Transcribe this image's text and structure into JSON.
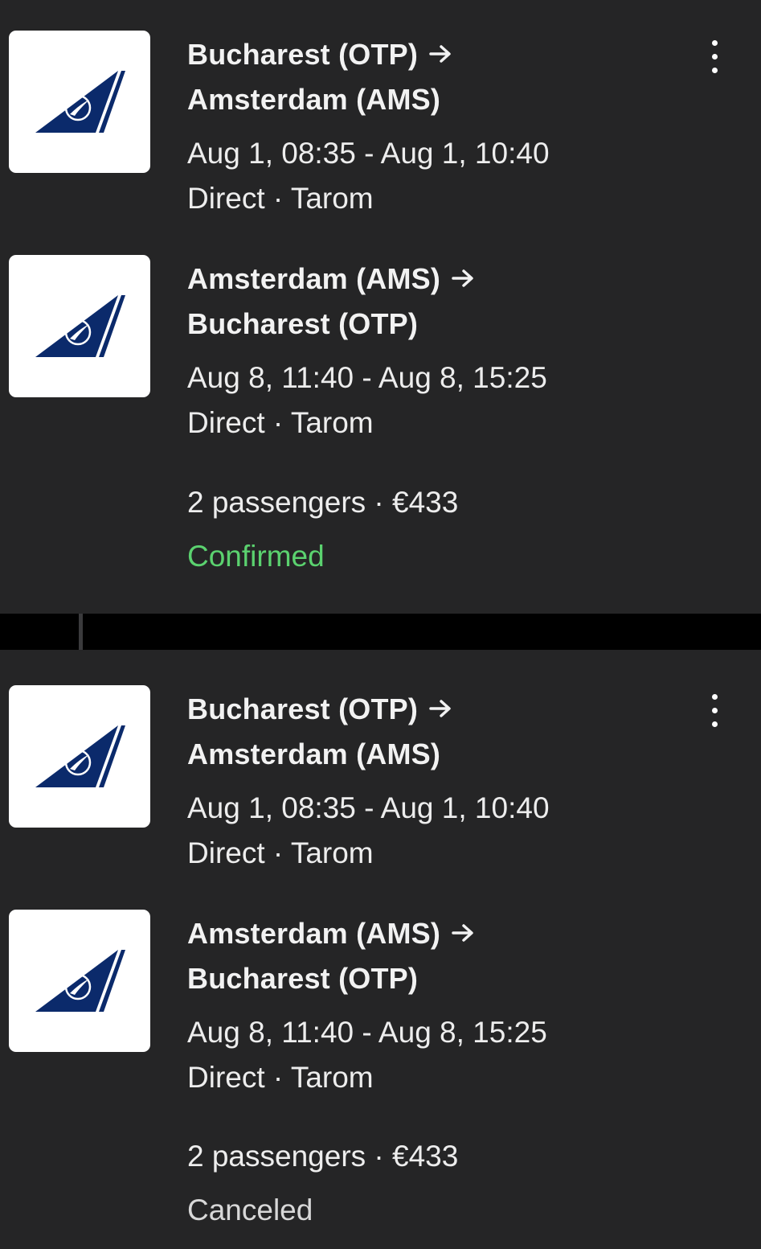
{
  "bookings": [
    {
      "legs": [
        {
          "airline_logo": "tarom-tail-logo",
          "route_line1": "Bucharest (OTP)",
          "route_line2": "Amsterdam (AMS)",
          "arrow_icon": "arrow-right-icon",
          "times": "Aug 1, 08:35 - Aug 1, 10:40",
          "details": "Direct · Tarom"
        },
        {
          "airline_logo": "tarom-tail-logo",
          "route_line1": "Amsterdam (AMS)",
          "route_line2": "Bucharest (OTP)",
          "arrow_icon": "arrow-right-icon",
          "times": "Aug 8, 11:40 - Aug 8, 15:25",
          "details": "Direct · Tarom"
        }
      ],
      "summary": "2 passengers · €433",
      "status": "Confirmed",
      "status_color": "#5bd26f",
      "menu_icon": "more-vertical-icon"
    },
    {
      "legs": [
        {
          "airline_logo": "tarom-tail-logo",
          "route_line1": "Bucharest (OTP)",
          "route_line2": "Amsterdam (AMS)",
          "arrow_icon": "arrow-right-icon",
          "times": "Aug 1, 08:35 - Aug 1, 10:40",
          "details": "Direct · Tarom"
        },
        {
          "airline_logo": "tarom-tail-logo",
          "route_line1": "Amsterdam (AMS)",
          "route_line2": "Bucharest (OTP)",
          "arrow_icon": "arrow-right-icon",
          "times": "Aug 8, 11:40 - Aug 8, 15:25",
          "details": "Direct · Tarom"
        }
      ],
      "summary": "2 passengers · €433",
      "status": "Canceled",
      "status_color": "#d8d8d8",
      "menu_icon": "more-vertical-icon"
    }
  ],
  "colors": {
    "background": "#252526",
    "separator": "#000000",
    "logo_blue": "#0b2a6b",
    "confirmed_green": "#5bd26f"
  }
}
